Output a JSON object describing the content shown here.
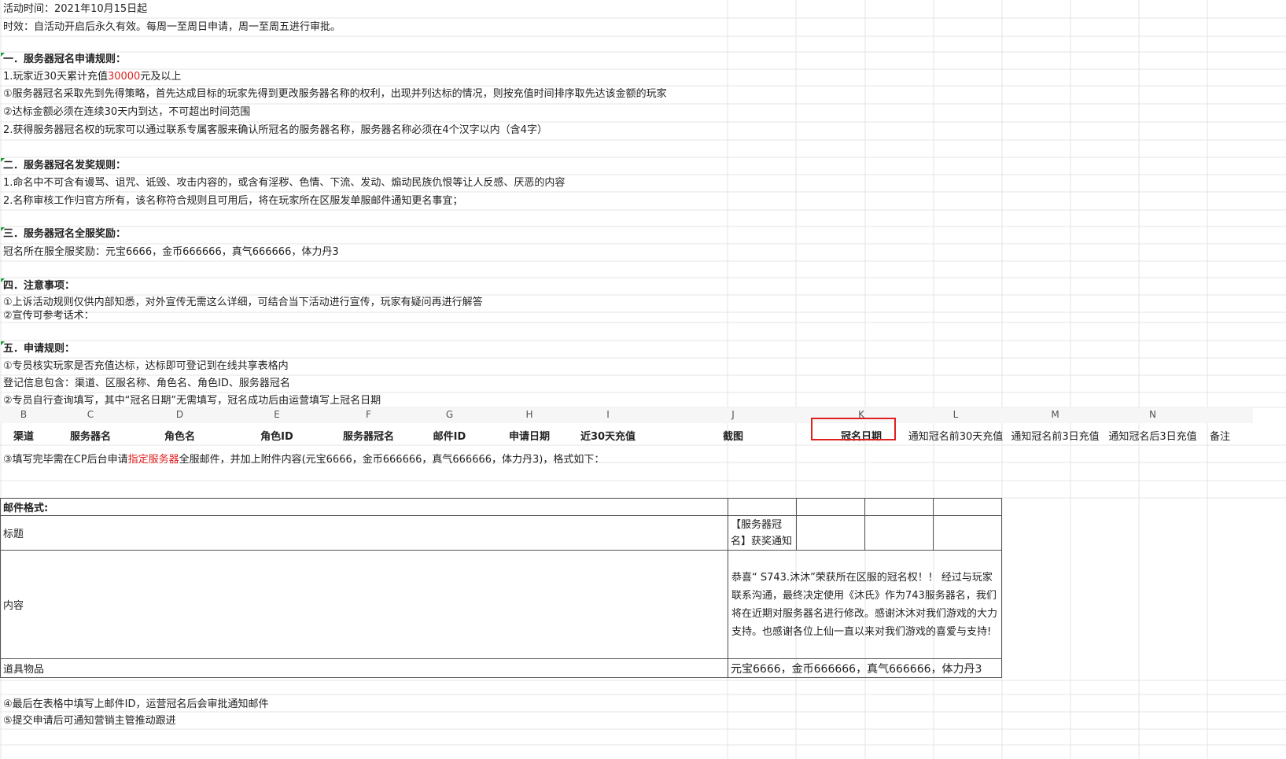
{
  "lines": {
    "activity_time": "活动时间：2021年10月15日起",
    "validity": "时效：自活动开启后永久有效。每周一至周日申请，周一至周五进行审批。",
    "s1_title": "一．服务器冠名申请规则：",
    "s1_l1_pre": "1.玩家近30天累计充值",
    "s1_l1_amount": "30000",
    "s1_l1_post": "元及以上",
    "s1_l2": "①服务器冠名采取先到先得策略，首先达成目标的玩家先得到更改服务器名称的权利，出现并列达标的情况，则按充值时间排序取先达该金额的玩家",
    "s1_l3": "②达标金额必须在连续30天内到达，不可超出时间范围",
    "s1_l4": "2.获得服务器冠名权的玩家可以通过联系专属客服来确认所冠名的服务器名称，服务器名称必须在4个汉字以内（含4字）",
    "s2_title": "二．服务器冠名发奖规则：",
    "s2_l1": "1.命名中不可含有谩骂、诅咒、诋毁、攻击内容的，或含有淫秽、色情、下流、发动、煽动民族仇恨等让人反感、厌恶的内容",
    "s2_l2": "2.名称审核工作归官方所有，该名称符合规则且可用后，将在玩家所在区服发单服邮件通知更名事宜；",
    "s3_title": "三．服务器冠名全服奖励：",
    "s3_l1": "冠名所在服全服奖励：元宝6666，金币666666，真气666666，体力丹3",
    "s4_title": "四．注意事项：",
    "s4_l1": "①上诉活动规则仅供内部知悉，对外宣传无需这么详细，可结合当下活动进行宣传，玩家有疑问再进行解答",
    "s4_l2": "②宣传可参考话术：",
    "s5_title": "五．申请规则：",
    "s5_l1": "①专员核实玩家是否充值达标，达标即可登记到在线共享表格内",
    "s5_l2": "登记信息包含：渠道、区服名称、角色名、角色ID、服务器冠名",
    "s5_l3": "②专员自行查询填写，其中“冠名日期”无需填写，冠名成功后由运营填写上冠名日期",
    "s5_l4_pre": "③填写完毕需在CP后台申请",
    "s5_l4_red": "指定服务器",
    "s5_l4_post": "全服邮件，并加上附件内容(元宝6666，金币666666，真气666666，体力丹3)，格式如下：",
    "s5_l5": "④最后在表格中填写上邮件ID，运营冠名后会审批通知邮件",
    "s5_l6": "⑤提交申请后可通知营销主管推动跟进"
  },
  "embedded_table": {
    "col_letters": [
      "B",
      "C",
      "D",
      "E",
      "F",
      "G",
      "H",
      "I",
      "J",
      "K",
      "L",
      "M",
      "N"
    ],
    "headers": [
      "渠道",
      "服务器名",
      "角色名",
      "角色ID",
      "服务器冠名",
      "邮件ID",
      "申请日期",
      "近30天充值",
      "截图",
      "冠名日期",
      "通知冠名前30天充值",
      "通知冠名前3日充值",
      "通知冠名后3日充值",
      "备注"
    ],
    "highlighted_header": "冠名日期"
  },
  "mail_format": {
    "heading": "邮件格式:",
    "title_label": "标题",
    "title_value": "【服务器冠名】获奖通知",
    "content_label": "内容",
    "content_value": "恭喜“ S743.沐沐”荣获所在区服的冠名权！！ 经过与玩家联系沟通，最终决定使用《沐氏》作为743服务器名，我们将在近期对服务器名进行修改。感谢沐沐对我们游戏的大力支持。也感谢各位上仙一直以来对我们游戏的喜爱与支持!",
    "items_label": "道具物品",
    "items_value": "元宝6666，金币666666，真气666666，体力丹3"
  },
  "colors": {
    "accent_red": "#e02020",
    "comment_marker": "#1a9a3a"
  }
}
